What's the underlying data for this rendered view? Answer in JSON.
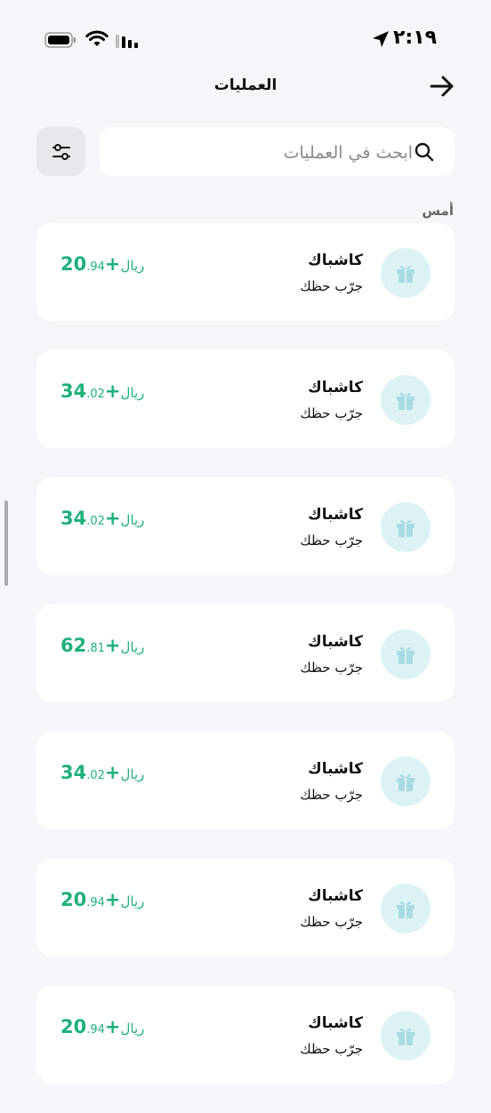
{
  "status_bar": {
    "time": "٢:١٩"
  },
  "header": {
    "title": "العمليات"
  },
  "search": {
    "placeholder": "ابحث في العمليات",
    "value": ""
  },
  "section": {
    "label": "أمس"
  },
  "transactions": [
    {
      "title": "كاشباك",
      "subtitle": "جرّب حظك",
      "sign": "+",
      "integer": "20",
      "decimal": ".94",
      "currency": "ريال"
    },
    {
      "title": "كاشباك",
      "subtitle": "جرّب حظك",
      "sign": "+",
      "integer": "34",
      "decimal": ".02",
      "currency": "ريال"
    },
    {
      "title": "كاشباك",
      "subtitle": "جرّب حظك",
      "sign": "+",
      "integer": "34",
      "decimal": ".02",
      "currency": "ريال"
    },
    {
      "title": "كاشباك",
      "subtitle": "جرّب حظك",
      "sign": "+",
      "integer": "62",
      "decimal": ".81",
      "currency": "ريال"
    },
    {
      "title": "كاشباك",
      "subtitle": "جرّب حظك",
      "sign": "+",
      "integer": "34",
      "decimal": ".02",
      "currency": "ريال"
    },
    {
      "title": "كاشباك",
      "subtitle": "جرّب حظك",
      "sign": "+",
      "integer": "20",
      "decimal": ".94",
      "currency": "ريال"
    },
    {
      "title": "كاشباك",
      "subtitle": "جرّب حظك",
      "sign": "+",
      "integer": "20",
      "decimal": ".94",
      "currency": "ريال"
    }
  ],
  "icons": {
    "back": "arrow-right-icon",
    "filter": "sliders-icon",
    "search": "search-icon",
    "transaction": "gift-icon"
  },
  "colors": {
    "amount": "#20B07A",
    "gift_bg": "#DDF2F5",
    "gift_fg": "#A8DBE3",
    "background": "#F6F6FA"
  }
}
